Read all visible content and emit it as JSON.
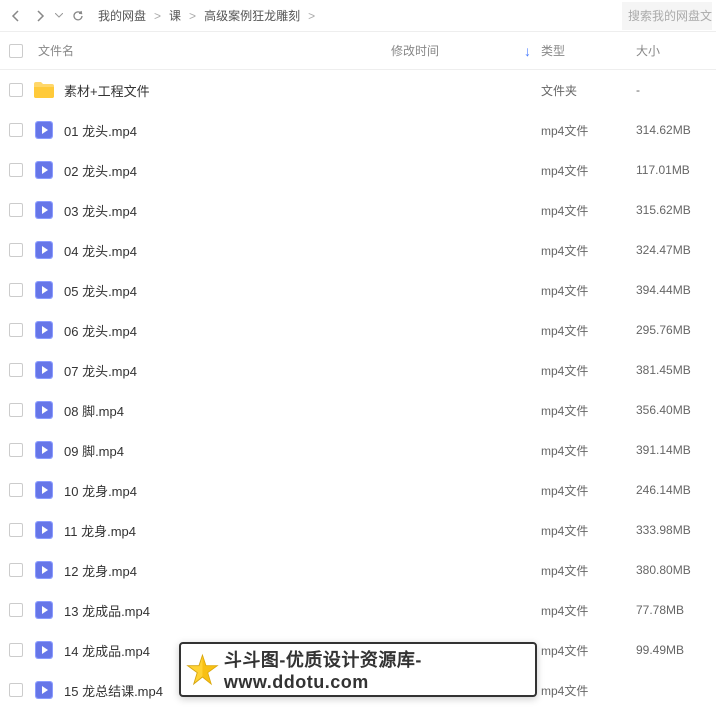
{
  "breadcrumb": {
    "items": [
      "我的网盘",
      "课",
      "高级案例狂龙雕刻"
    ],
    "sep": ">"
  },
  "search": {
    "placeholder": "搜索我的网盘文件"
  },
  "headers": {
    "name": "文件名",
    "date": "修改时间",
    "type": "类型",
    "size": "大小"
  },
  "files": [
    {
      "name": "素材+工程文件",
      "type": "文件夹",
      "size": "-",
      "kind": "folder"
    },
    {
      "name": "01 龙头.mp4",
      "type": "mp4文件",
      "size": "314.62MB",
      "kind": "video"
    },
    {
      "name": "02 龙头.mp4",
      "type": "mp4文件",
      "size": "117.01MB",
      "kind": "video"
    },
    {
      "name": "03 龙头.mp4",
      "type": "mp4文件",
      "size": "315.62MB",
      "kind": "video"
    },
    {
      "name": "04 龙头.mp4",
      "type": "mp4文件",
      "size": "324.47MB",
      "kind": "video"
    },
    {
      "name": "05 龙头.mp4",
      "type": "mp4文件",
      "size": "394.44MB",
      "kind": "video"
    },
    {
      "name": "06 龙头.mp4",
      "type": "mp4文件",
      "size": "295.76MB",
      "kind": "video"
    },
    {
      "name": "07 龙头.mp4",
      "type": "mp4文件",
      "size": "381.45MB",
      "kind": "video"
    },
    {
      "name": "08 脚.mp4",
      "type": "mp4文件",
      "size": "356.40MB",
      "kind": "video"
    },
    {
      "name": "09 脚.mp4",
      "type": "mp4文件",
      "size": "391.14MB",
      "kind": "video"
    },
    {
      "name": "10 龙身.mp4",
      "type": "mp4文件",
      "size": "246.14MB",
      "kind": "video"
    },
    {
      "name": "11 龙身.mp4",
      "type": "mp4文件",
      "size": "333.98MB",
      "kind": "video"
    },
    {
      "name": "12 龙身.mp4",
      "type": "mp4文件",
      "size": "380.80MB",
      "kind": "video"
    },
    {
      "name": "13 龙成品.mp4",
      "type": "mp4文件",
      "size": "77.78MB",
      "kind": "video"
    },
    {
      "name": "14 龙成品.mp4",
      "type": "mp4文件",
      "size": "99.49MB",
      "kind": "video"
    },
    {
      "name": "15 龙总结课.mp4",
      "type": "mp4文件",
      "size": "",
      "kind": "video"
    }
  ],
  "watermark": {
    "text": "斗斗图-优质设计资源库-www.ddotu.com"
  }
}
